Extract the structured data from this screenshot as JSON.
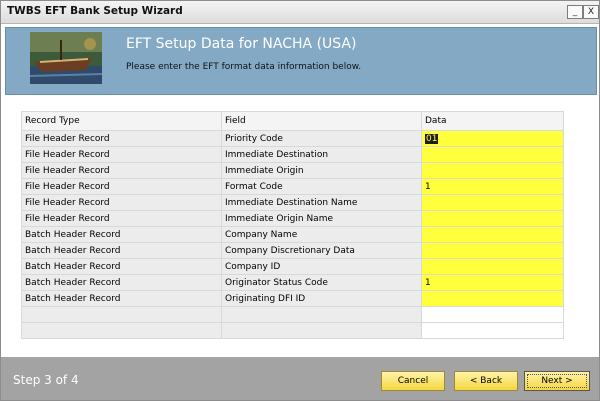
{
  "window": {
    "title": "TWBS EFT Bank Setup Wizard",
    "minimize_label": "_",
    "close_label": "X"
  },
  "banner": {
    "heading": "EFT Setup Data for NACHA (USA)",
    "subtitle": "Please enter the EFT format data information below."
  },
  "table": {
    "columns": [
      "Record Type",
      "Field",
      "Data"
    ],
    "rows": [
      {
        "record_type": "File Header Record",
        "field": "Priority Code",
        "data": "01"
      },
      {
        "record_type": "File Header Record",
        "field": "Immediate Destination",
        "data": ""
      },
      {
        "record_type": "File Header Record",
        "field": "Immediate Origin",
        "data": ""
      },
      {
        "record_type": "File Header Record",
        "field": "Format Code",
        "data": "1"
      },
      {
        "record_type": "File Header Record",
        "field": "Immediate Destination Name",
        "data": ""
      },
      {
        "record_type": "File Header Record",
        "field": "Immediate Origin Name",
        "data": ""
      },
      {
        "record_type": "Batch Header Record",
        "field": "Company Name",
        "data": ""
      },
      {
        "record_type": "Batch Header Record",
        "field": "Company Discretionary Data",
        "data": ""
      },
      {
        "record_type": "Batch Header Record",
        "field": "Company ID",
        "data": ""
      },
      {
        "record_type": "Batch Header Record",
        "field": "Originator Status Code",
        "data": "1"
      },
      {
        "record_type": "Batch Header Record",
        "field": "Originating DFI ID",
        "data": ""
      }
    ]
  },
  "footer": {
    "step": "Step 3 of 4",
    "cancel": "Cancel",
    "back": "< Back",
    "next": "Next >"
  },
  "colors": {
    "banner": "#84a9c4",
    "data_cell": "#ffff3c",
    "footer": "#a3a3a3",
    "button": "#f5d640"
  }
}
